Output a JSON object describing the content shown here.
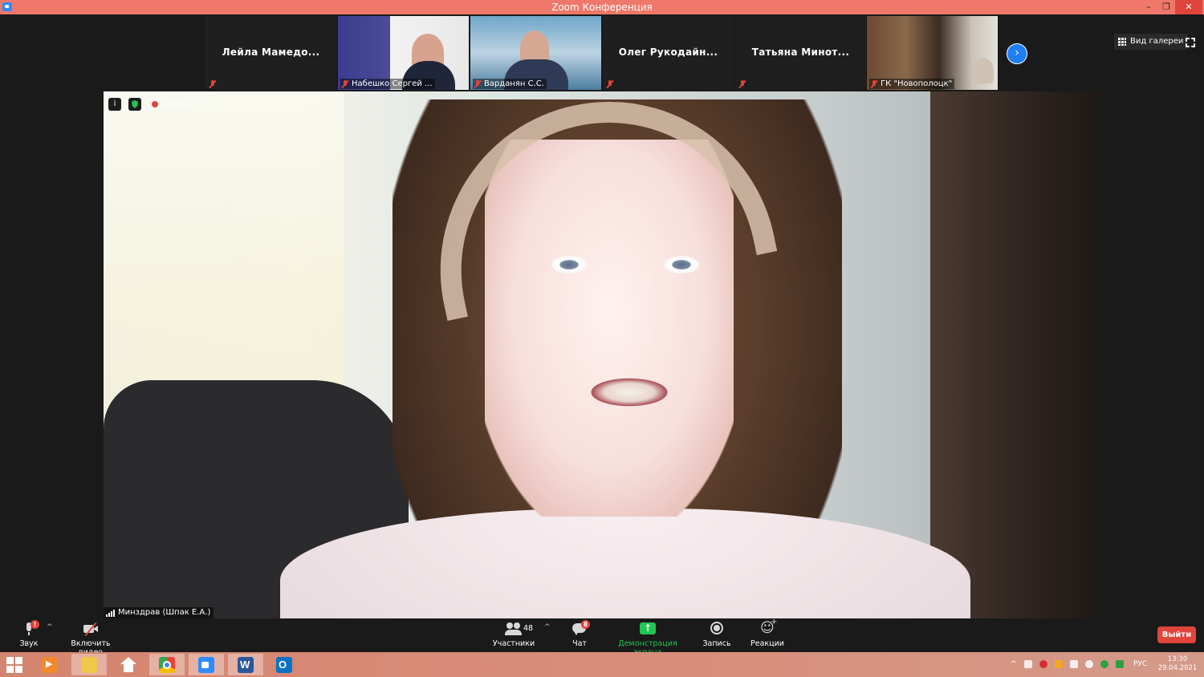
{
  "window": {
    "title": "Zoom Конференция",
    "minimize": "–",
    "maximize": "❐",
    "close": "✕"
  },
  "thumbnails": [
    {
      "name": "Лейла  Мамедо...",
      "type": "name"
    },
    {
      "name": "Набешко Сергей ...",
      "type": "video"
    },
    {
      "name": "Варданян С.С.",
      "type": "video"
    },
    {
      "name": "Олег  Рукодайн...",
      "type": "name"
    },
    {
      "name": "Татьяна  Минот...",
      "type": "name"
    },
    {
      "name": "ГК \"Новополоцк\"",
      "type": "video"
    }
  ],
  "gallery_view_label": "Вид галереи",
  "next_page": "›",
  "main_video": {
    "speaker_label": "Минздрав (Шпак Е.А.)",
    "recording_label": "Запись",
    "info": "i"
  },
  "toolbar": {
    "audio": {
      "label": "Звук",
      "badge": "!"
    },
    "video": {
      "label": "Включить видео"
    },
    "participants": {
      "label": "Участники",
      "count": "48"
    },
    "chat": {
      "label": "Чат",
      "badge": "8"
    },
    "share": {
      "label": "Демонстрация экрана"
    },
    "record": {
      "label": "Запись"
    },
    "reactions": {
      "label": "Реакции"
    },
    "leave": {
      "label": "Выйти"
    },
    "caret": "^"
  },
  "taskbar": {
    "language": "РУС",
    "time": "13:30",
    "date": "29.04.2021",
    "overflow": "^"
  },
  "colors": {
    "titlebar": "#f0786a",
    "leave": "#e0443a",
    "share_green": "#23c552",
    "zoom_blue": "#1e7ff5"
  }
}
